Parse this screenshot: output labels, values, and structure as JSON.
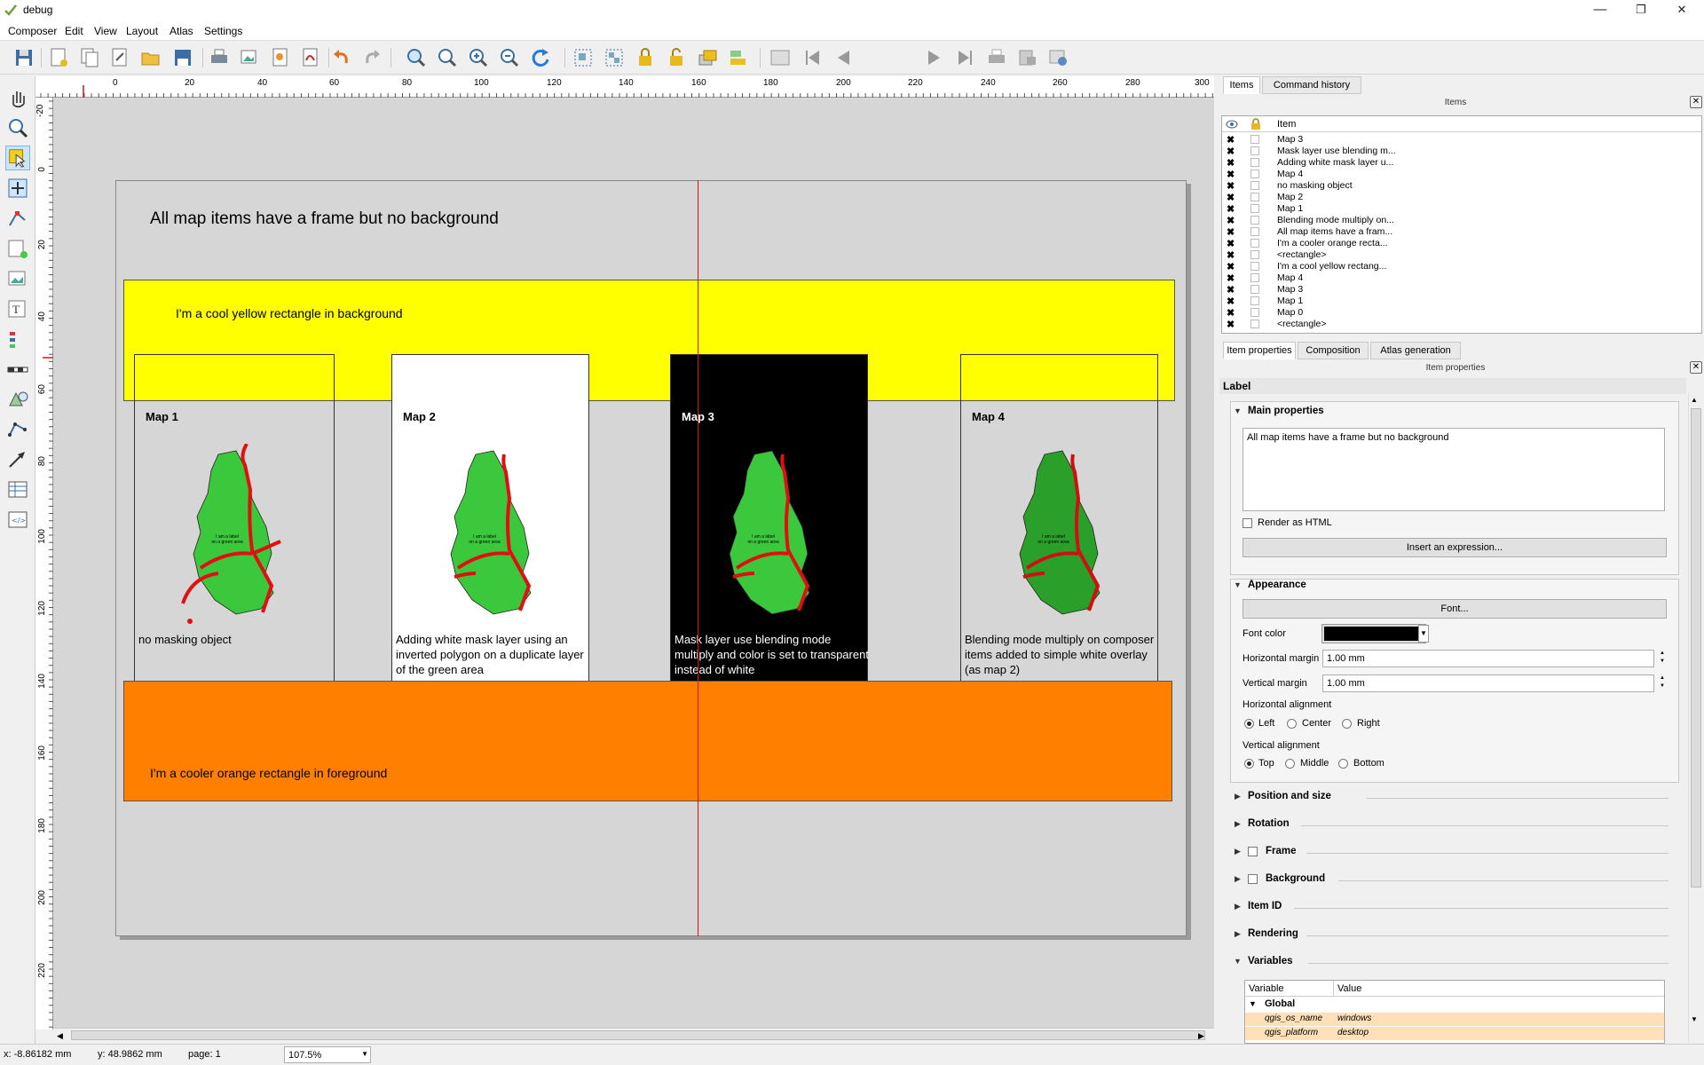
{
  "window": {
    "title": "debug",
    "min": "—",
    "max": "❐",
    "close": "✕"
  },
  "menu": [
    "Composer",
    "Edit",
    "View",
    "Layout",
    "Atlas",
    "Settings"
  ],
  "toolbar": {
    "page_value": "1"
  },
  "ruler_h": [
    "0",
    "20",
    "40",
    "60",
    "80",
    "100",
    "120",
    "140",
    "160",
    "180",
    "200",
    "220",
    "240",
    "260",
    "280",
    "300"
  ],
  "ruler_v": [
    "-20",
    "0",
    "20",
    "40",
    "60",
    "80",
    "100",
    "120",
    "140",
    "160",
    "180",
    "200",
    "220"
  ],
  "canvas": {
    "page_title": "All map items have a frame but no background",
    "yellow_text": "I'm a cool yellow rectangle in background",
    "orange_text": "I'm a cooler orange rectangle in foreground",
    "maps": [
      {
        "title": "Map 1",
        "caption": "no masking object",
        "map_label": "I am a label on a green area intersected by red roads... don't judge me!"
      },
      {
        "title": "Map 2",
        "caption": "Adding white mask layer using an inverted polygon on a duplicate layer of the green area",
        "map_label": "I am a label on a green area traversed by red road... don't judge me!"
      },
      {
        "title": "Map 3",
        "caption": "Mask layer use blending mode multiply and color is set to transparent instead of white",
        "map_label": "I am a label on a green area traversed by red road... don't judge me!"
      },
      {
        "title": "Map 4",
        "caption": "Blending mode multiply on composer items added to simple white overlay (as map 2)",
        "map_label": "I am a label on a green area traversed by red road... don't judge me!"
      }
    ],
    "colors": {
      "yellow": "#ffff00",
      "orange": "#ff8000",
      "green": "#3cc83c",
      "road": "#e01010",
      "guide": "#e01010"
    }
  },
  "status": {
    "x": "x: -8.86182 mm",
    "y": "y: 48.9862 mm",
    "page": "page: 1",
    "zoom": "107.5%"
  },
  "right_panel": {
    "top_tabs": [
      "Items",
      "Command history"
    ],
    "items_header": "Items",
    "tree_header": "Item",
    "items": [
      "Map 3",
      "Mask layer use blending m...",
      "Adding white mask layer u...",
      "Map 4",
      "no masking object",
      "Map 2",
      "Map 1",
      "Blending mode multiply on...",
      "All map items have a fram...",
      "I'm a cooler orange recta...",
      "<rectangle>",
      "I'm a cool yellow rectang...",
      "Map 4",
      "Map 3",
      "Map 1",
      "Map 0",
      "<rectangle>"
    ],
    "bottom_tabs": [
      "Item properties",
      "Composition",
      "Atlas generation"
    ],
    "props_header": "Item properties",
    "type_label": "Label",
    "main_props": "Main properties",
    "label_text": "All map items have a frame but no background",
    "render_html": "Render as HTML",
    "insert_expr": "Insert an expression...",
    "appearance": "Appearance",
    "font_btn": "Font...",
    "font_color": "Font color",
    "h_margin_label": "Horizontal margin",
    "h_margin": "1.00 mm",
    "v_margin_label": "Vertical margin",
    "v_margin": "1.00 mm",
    "h_align_label": "Horizontal alignment",
    "h_align": [
      "Left",
      "Center",
      "Right"
    ],
    "v_align_label": "Vertical alignment",
    "v_align": [
      "Top",
      "Middle",
      "Bottom"
    ],
    "sections": [
      "Position and size",
      "Rotation",
      "Frame",
      "Background",
      "Item ID",
      "Rendering",
      "Variables"
    ],
    "var_headers": [
      "Variable",
      "Value"
    ],
    "var_group": "Global",
    "vars": [
      {
        "name": "qgis_os_name",
        "value": "windows"
      },
      {
        "name": "qgis_platform",
        "value": "desktop"
      }
    ]
  }
}
